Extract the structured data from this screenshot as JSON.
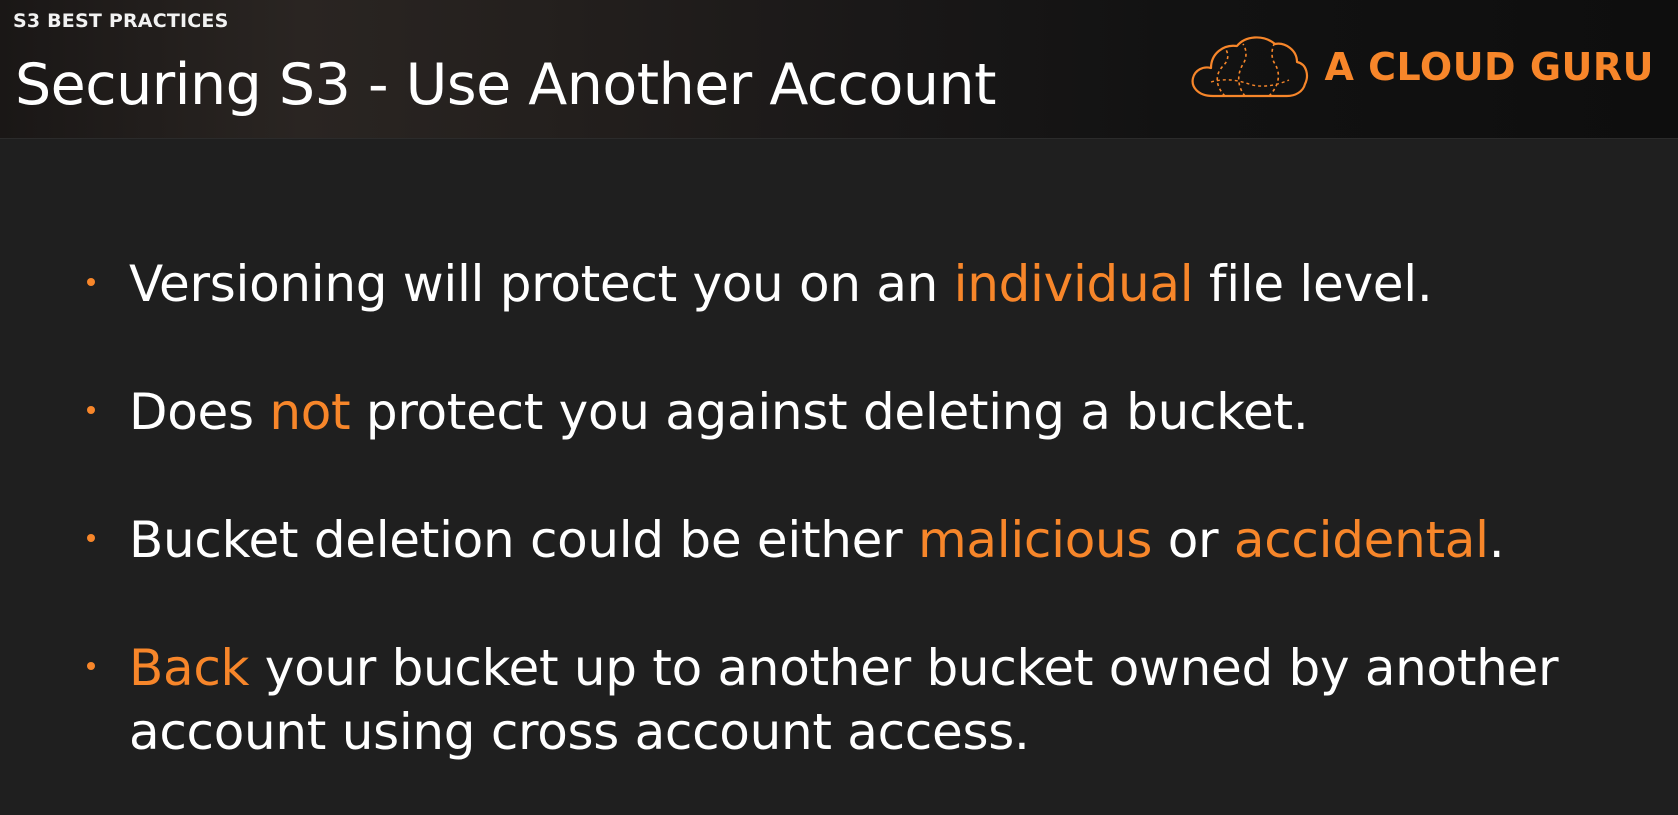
{
  "header": {
    "section_label": "S3 BEST PRACTICES",
    "title": "Securing S3 - Use Another Account",
    "brand": {
      "name": "A CLOUD GURU",
      "logo_icon": "cloud-logo-icon",
      "color": "#f7862a"
    }
  },
  "bullets": [
    {
      "parts": [
        {
          "text": "Versioning will protect you on an "
        },
        {
          "text": "individual",
          "highlight": true
        },
        {
          "text": " file level."
        }
      ]
    },
    {
      "parts": [
        {
          "text": "Does "
        },
        {
          "text": "not",
          "highlight": true
        },
        {
          "text": " protect you against deleting a bucket."
        }
      ]
    },
    {
      "parts": [
        {
          "text": "Bucket deletion could be either "
        },
        {
          "text": "malicious",
          "highlight": true
        },
        {
          "text": " or "
        },
        {
          "text": "accidental",
          "highlight": true
        },
        {
          "text": "."
        }
      ]
    },
    {
      "parts": [
        {
          "text": "Back",
          "highlight": true
        },
        {
          "text": " your bucket up to another bucket owned by another account using cross account access."
        }
      ]
    }
  ],
  "colors": {
    "accent": "#f7862a",
    "background": "#1f1f1f",
    "text": "#ffffff"
  }
}
